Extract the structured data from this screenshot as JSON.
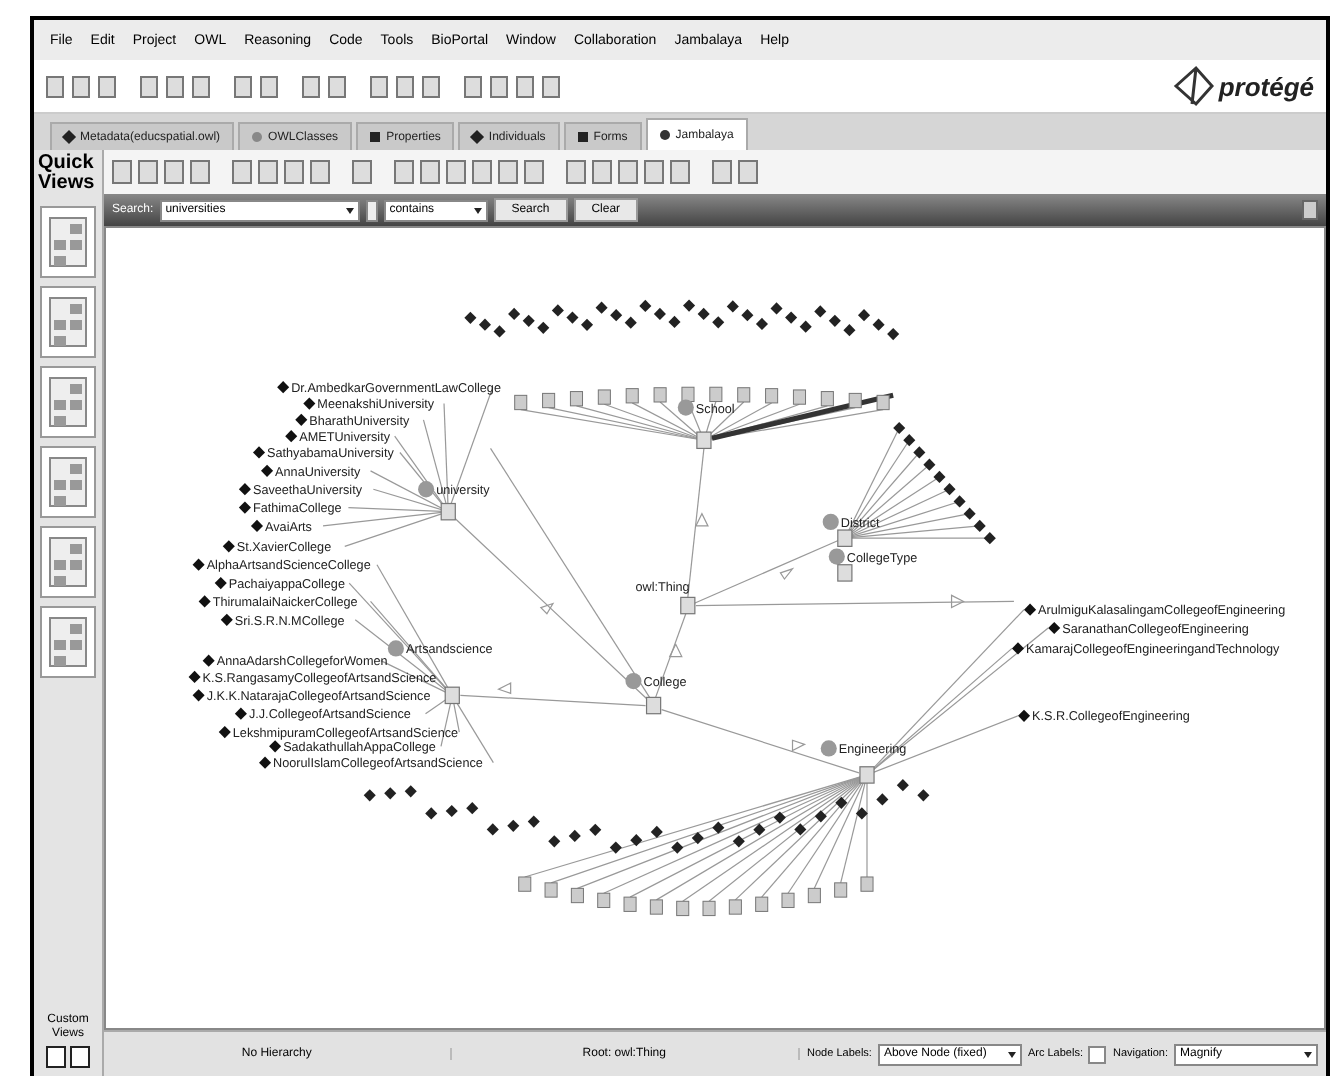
{
  "menu": [
    "File",
    "Edit",
    "Project",
    "OWL",
    "Reasoning",
    "Code",
    "Tools",
    "BioPortal",
    "Window",
    "Collaboration",
    "Jambalaya",
    "Help"
  ],
  "logo": "protégé",
  "tabs": [
    {
      "label": "Metadata(educspatial.owl)",
      "selected": false
    },
    {
      "label": "OWLClasses",
      "selected": false
    },
    {
      "label": "Properties",
      "selected": false
    },
    {
      "label": "Individuals",
      "selected": false
    },
    {
      "label": "Forms",
      "selected": false
    },
    {
      "label": "Jambalaya",
      "selected": true
    }
  ],
  "quick_views": "Quick Views",
  "search": {
    "label": "Search:",
    "value": "universities",
    "mode": "contains",
    "search_button": "Search",
    "clear_button": "Clear"
  },
  "graph": {
    "classes": [
      {
        "label": "School",
        "kind": "class"
      },
      {
        "label": "owl:Thing",
        "kind": "root"
      },
      {
        "label": "university",
        "kind": "class"
      },
      {
        "label": "College",
        "kind": "class"
      },
      {
        "label": "District",
        "kind": "class"
      },
      {
        "label": "CollegeType",
        "kind": "class"
      },
      {
        "label": "Artsandscience",
        "kind": "class"
      },
      {
        "label": "Engineering",
        "kind": "class"
      }
    ],
    "instances_left": [
      "Dr.AmbedkarGovernmentLawCollege",
      "MeenakshiUniversity",
      "BharathUniversity",
      "AMETUniversity",
      "SathyabamaUniversity",
      "AnnaUniversity",
      "SaveethaUniversity",
      "FathimaCollege",
      "AvaiArts",
      "St.XavierCollege",
      "AlphaArtsandScienceCollege",
      "PachaiyappaCollege",
      "ThirumalaiNaickerCollege",
      "Sri.S.R.N.MCollege",
      "AnnaAdarshCollegeforWomen",
      "K.S.RangasamyCollegeofArtsandScience",
      "J.K.K.NatarajaCollegeofArtsandScience",
      "J.J.CollegeofArtsandScience",
      "LekshmipuramCollegeofArtsandScience",
      "SadakathullahAppaCollege",
      "NoorulIslamCollegeofArtsandScience"
    ],
    "instances_right": [
      "ArulmiguKalasalingamCollegeofEngineering",
      "SaranathanCollegeofEngineering",
      "KamarajCollegeofEngineeringandTechnology",
      "K.S.R.CollegeofEngineering"
    ]
  },
  "custom_views": "Custom Views",
  "status_bar": {
    "hierarchy": "No Hierarchy",
    "root": "Root: owl:Thing",
    "node_labels_label": "Node Labels:",
    "node_labels": "Above Node (fixed)",
    "arc_labels_label": "Arc Labels:",
    "arc_labels_checked": false,
    "navigation_label": "Navigation:",
    "navigation": "Magnify"
  }
}
